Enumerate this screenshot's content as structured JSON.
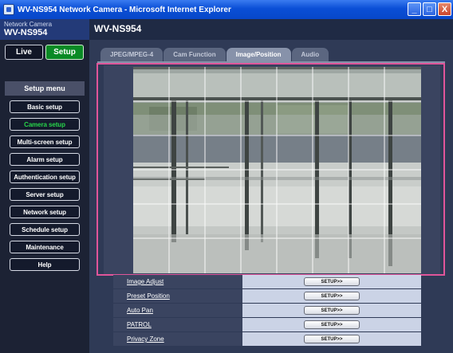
{
  "window": {
    "title": "WV-NS954 Network Camera - Microsoft Internet Explorer",
    "buttons": [
      "_",
      "□",
      "X"
    ]
  },
  "header": {
    "brand_sub": "Network Camera",
    "brand_model": "WV-NS954",
    "page_title": "WV-NS954"
  },
  "mode": {
    "live_label": "Live",
    "setup_label": "Setup"
  },
  "sidebar": {
    "menu_title": "Setup menu",
    "items": [
      {
        "label": "Basic setup"
      },
      {
        "label": "Camera setup"
      },
      {
        "label": "Multi-screen setup"
      },
      {
        "label": "Alarm setup"
      },
      {
        "label": "Authentication setup"
      },
      {
        "label": "Server setup"
      },
      {
        "label": "Network setup"
      },
      {
        "label": "Schedule setup"
      },
      {
        "label": "Maintenance"
      }
    ],
    "help_label": "Help"
  },
  "tabs": [
    {
      "label": "JPEG/MPEG-4"
    },
    {
      "label": "Cam Function"
    },
    {
      "label": "Image/Position"
    },
    {
      "label": "Audio"
    }
  ],
  "setup_rows": [
    {
      "label": "Image Adjust",
      "button": "SETUP>>"
    },
    {
      "label": "Preset Position",
      "button": "SETUP>>"
    },
    {
      "label": "Auto Pan",
      "button": "SETUP>>"
    },
    {
      "label": "PATROL",
      "button": "SETUP>>"
    },
    {
      "label": "Privacy Zone",
      "button": "SETUP>>"
    }
  ],
  "colors": {
    "accent_green": "#0a8a25",
    "active_item_text": "#27d44a",
    "highlight_border": "#e0559a"
  }
}
